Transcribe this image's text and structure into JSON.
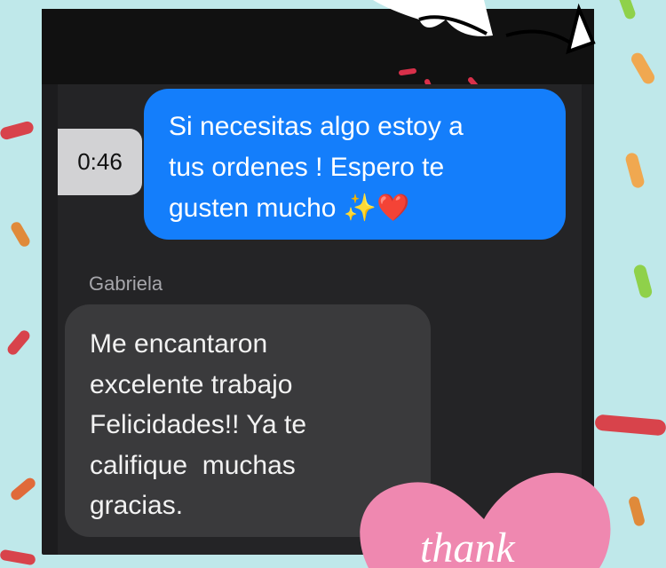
{
  "chat": {
    "timestamp": "0:46",
    "sent_message": {
      "lines": [
        "Si necesitas algo estoy a",
        "tus ordenes ! Espero te",
        "gusten mucho ✨❤️"
      ]
    },
    "sender_name": "Gabriela",
    "received_message": {
      "lines": [
        "Me encantaron",
        "excelente trabajo",
        "Felicidades!! Ya te",
        "califique  muchas",
        "gracias."
      ]
    }
  },
  "stickers": {
    "heart_text": "thank"
  },
  "colors": {
    "background": "#bfe8ea",
    "sent_bubble": "#147efb",
    "received_bubble": "#3a3a3c",
    "heart": "#ef88b0"
  }
}
